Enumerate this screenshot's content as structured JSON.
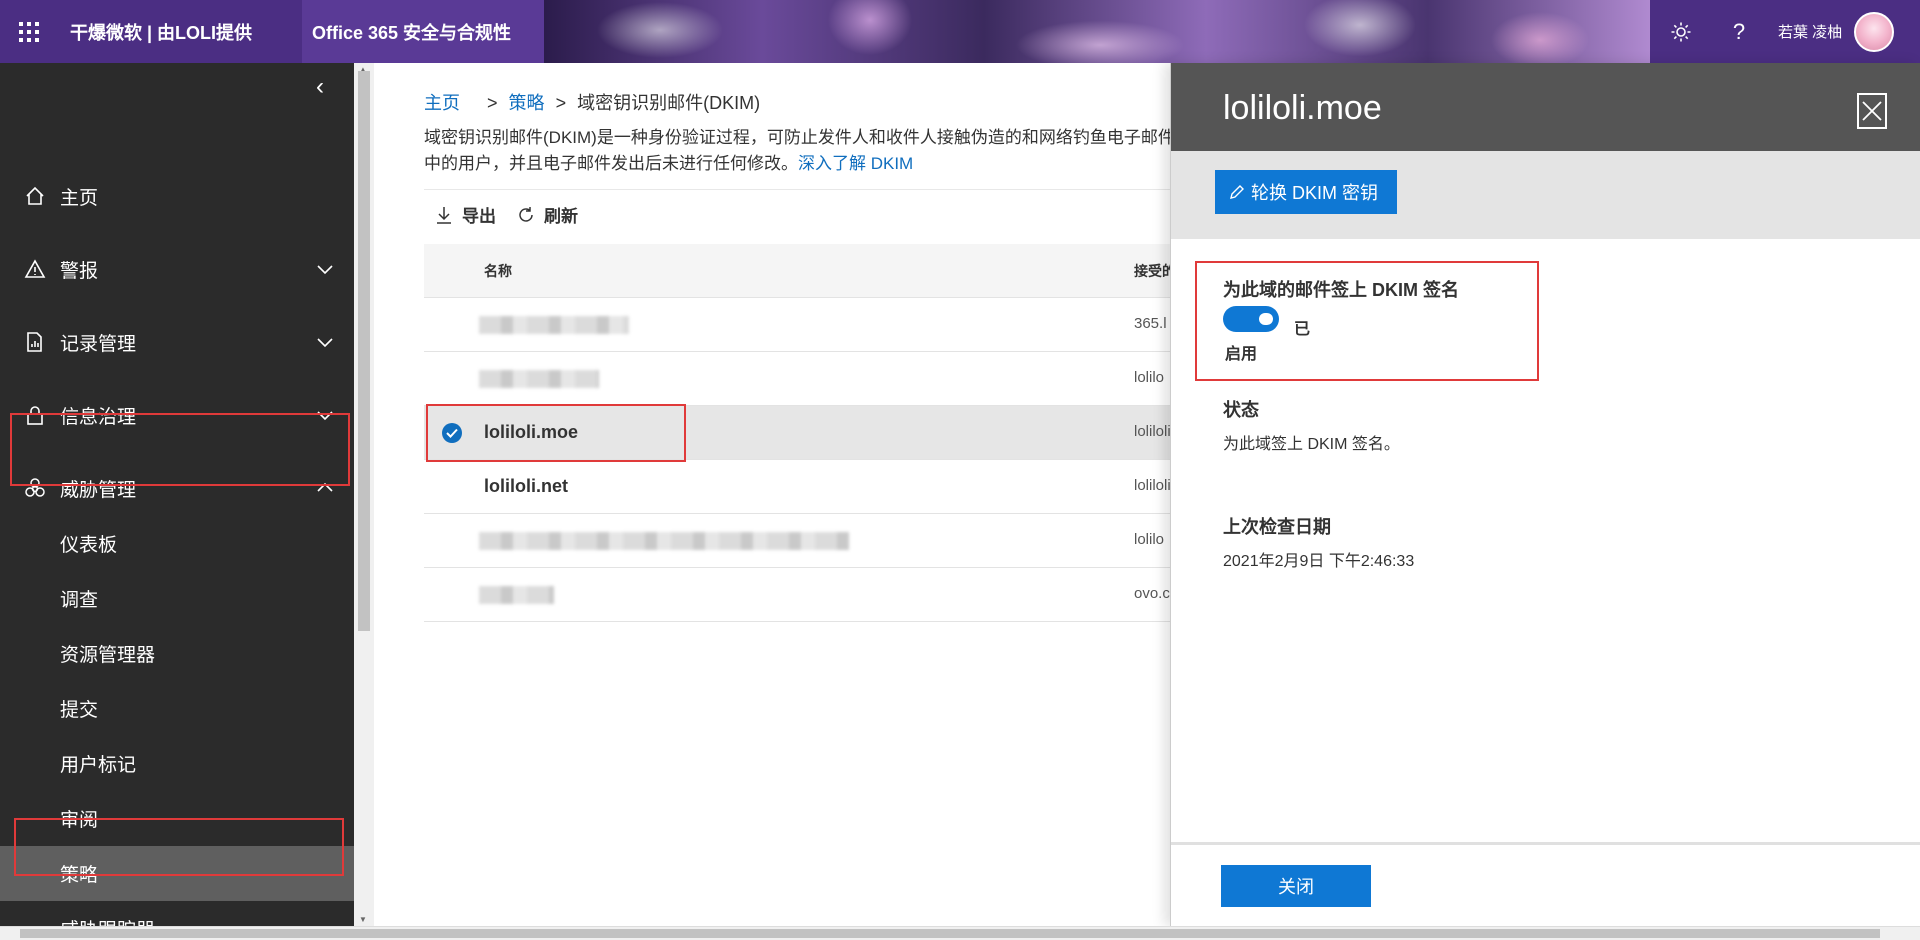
{
  "topbar": {
    "brand": "干爆微软 | 由LOLI提供",
    "product": "Office 365 安全与合规性",
    "user_name": "若葉 凌柚",
    "settings_icon": "gear-icon",
    "help_icon": "question-icon",
    "help_glyph": "?"
  },
  "sidebar": {
    "collapse_glyph": "‹",
    "items": [
      {
        "label": "主页",
        "icon": "home-icon"
      },
      {
        "label": "警报",
        "icon": "warning-icon"
      },
      {
        "label": "记录管理",
        "icon": "records-icon"
      },
      {
        "label": "信息治理",
        "icon": "lock-icon"
      },
      {
        "label": "威胁管理",
        "icon": "biohazard-icon"
      }
    ],
    "sub_items": [
      {
        "label": "仪表板"
      },
      {
        "label": "调查"
      },
      {
        "label": "资源管理器"
      },
      {
        "label": "提交"
      },
      {
        "label": "用户标记"
      },
      {
        "label": "审阅"
      },
      {
        "label": "策略"
      },
      {
        "label": "威胁跟踪器"
      }
    ]
  },
  "main": {
    "breadcrumb": {
      "home": "主页",
      "policy": "策略",
      "current": "域密钥识别邮件(DKIM)",
      "sep": ">"
    },
    "description_line1": "域密钥识别邮件(DKIM)是一种身份验证过程，可防止发件人和收件人接触伪造的和网络钓鱼电子邮件",
    "description_line2": "中的用户，并且电子邮件发出后未进行任何修改。",
    "learn_more": "深入了解 DKIM",
    "toolbar": {
      "export": "导出",
      "refresh": "刷新"
    },
    "table": {
      "headers": {
        "name": "名称",
        "accepted": "接受的域"
      },
      "rows": [
        {
          "name": "",
          "accepted": "365.l"
        },
        {
          "name": "",
          "accepted": "lolilo"
        },
        {
          "name": "loliloli.moe",
          "accepted": "loliloli"
        },
        {
          "name": "loliloli.net",
          "accepted": "loliloli"
        },
        {
          "name": "",
          "accepted": "lolilo"
        },
        {
          "name": "",
          "accepted": "ovo.c"
        }
      ]
    }
  },
  "panel": {
    "title": "loliloli.moe",
    "rotate_button": "轮换 DKIM 密钥",
    "sign_label": "为此域的邮件签上 DKIM 签名",
    "toggle_state_1": "已",
    "toggle_state_2": "启用",
    "status_title": "状态",
    "status_value": "为此域签上 DKIM 签名。",
    "last_checked_title": "上次检查日期",
    "last_checked_value": "2021年2月9日 下午2:46:33",
    "close_button": "关闭"
  },
  "colors": {
    "accent": "#0f78d4",
    "highlight": "#e03a3a",
    "sidebar_bg": "#2b2b2b",
    "topbar_bg": "#4b2e83"
  }
}
